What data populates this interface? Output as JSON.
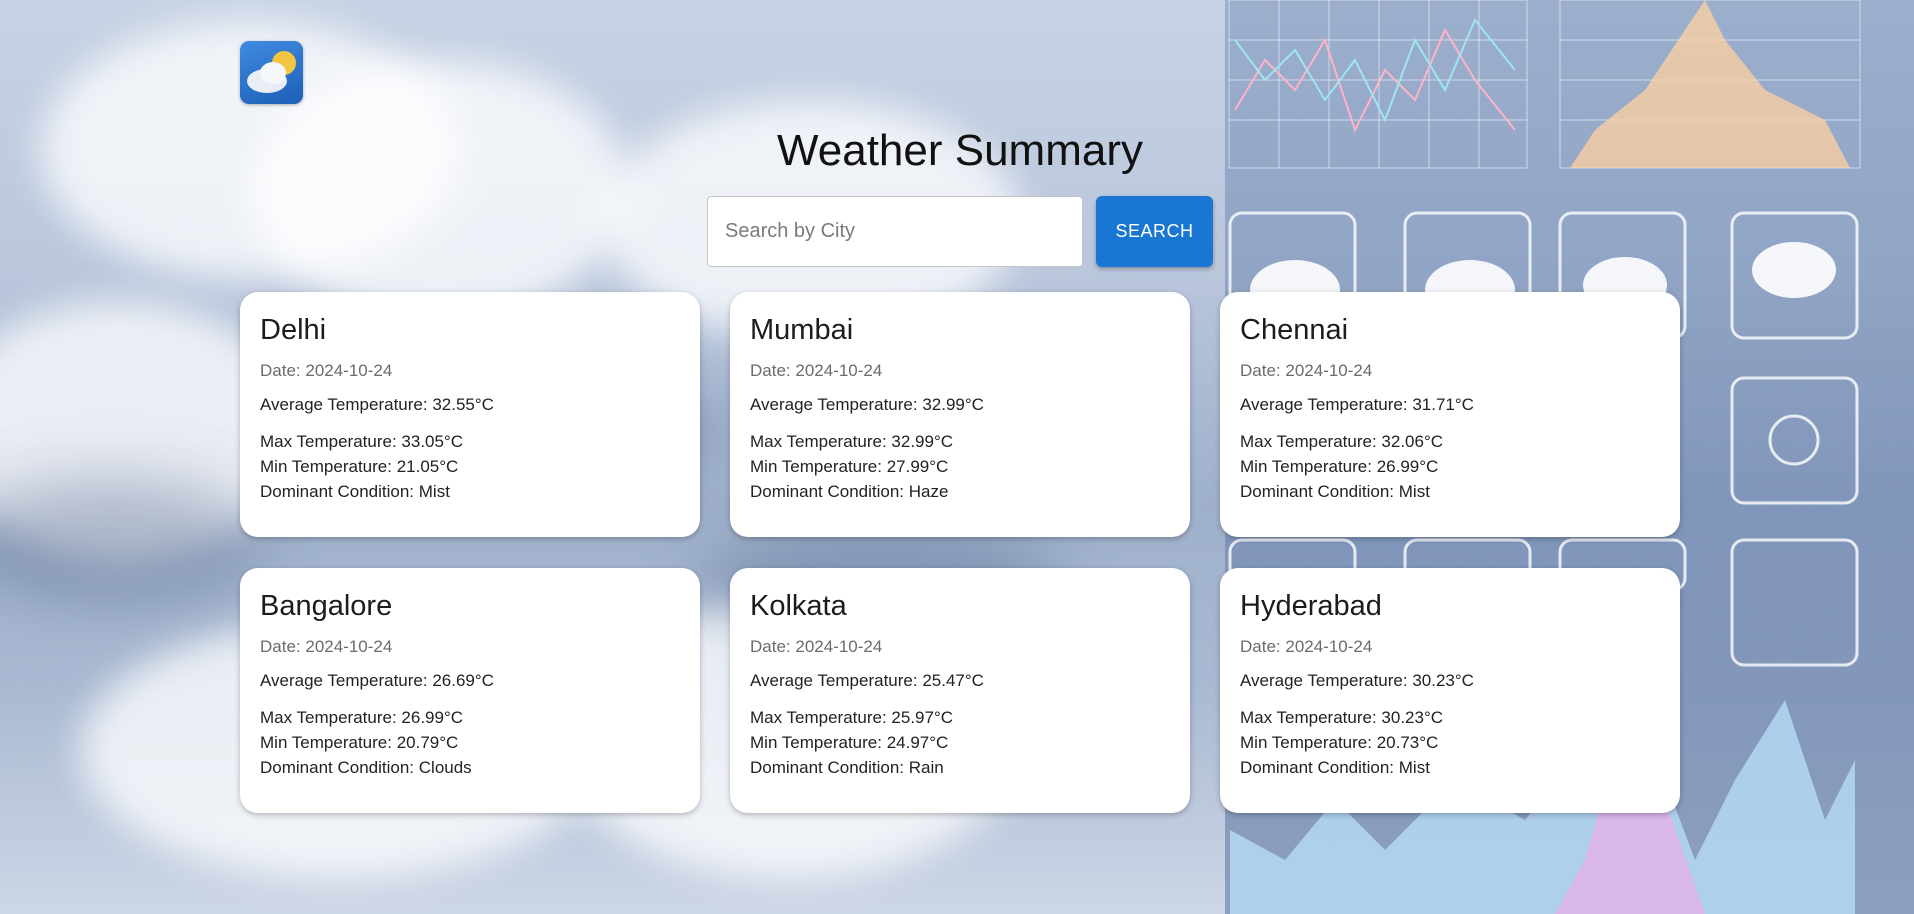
{
  "header": {
    "title": "Weather Summary",
    "logo_icon": "partly-cloudy-icon"
  },
  "search": {
    "placeholder": "Search by City",
    "value": "",
    "button_label": "SEARCH"
  },
  "labels": {
    "date": "Date: ",
    "avg": "Average Temperature: ",
    "max": "Max Temperature: ",
    "min": "Min Temperature: ",
    "condition": "Dominant Condition: "
  },
  "cities": [
    {
      "name": "Delhi",
      "date": "2024-10-24",
      "avg": "32.55°C",
      "max": "33.05°C",
      "min": "21.05°C",
      "condition": "Mist"
    },
    {
      "name": "Mumbai",
      "date": "2024-10-24",
      "avg": "32.99°C",
      "max": "32.99°C",
      "min": "27.99°C",
      "condition": "Haze"
    },
    {
      "name": "Chennai",
      "date": "2024-10-24",
      "avg": "31.71°C",
      "max": "32.06°C",
      "min": "26.99°C",
      "condition": "Mist"
    },
    {
      "name": "Bangalore",
      "date": "2024-10-24",
      "avg": "26.69°C",
      "max": "26.99°C",
      "min": "20.79°C",
      "condition": "Clouds"
    },
    {
      "name": "Kolkata",
      "date": "2024-10-24",
      "avg": "25.47°C",
      "max": "25.97°C",
      "min": "24.97°C",
      "condition": "Rain"
    },
    {
      "name": "Hyderabad",
      "date": "2024-10-24",
      "avg": "30.23°C",
      "max": "30.23°C",
      "min": "20.73°C",
      "condition": "Mist"
    }
  ],
  "colors": {
    "accent": "#1976d2",
    "card_bg": "#ffffff"
  }
}
